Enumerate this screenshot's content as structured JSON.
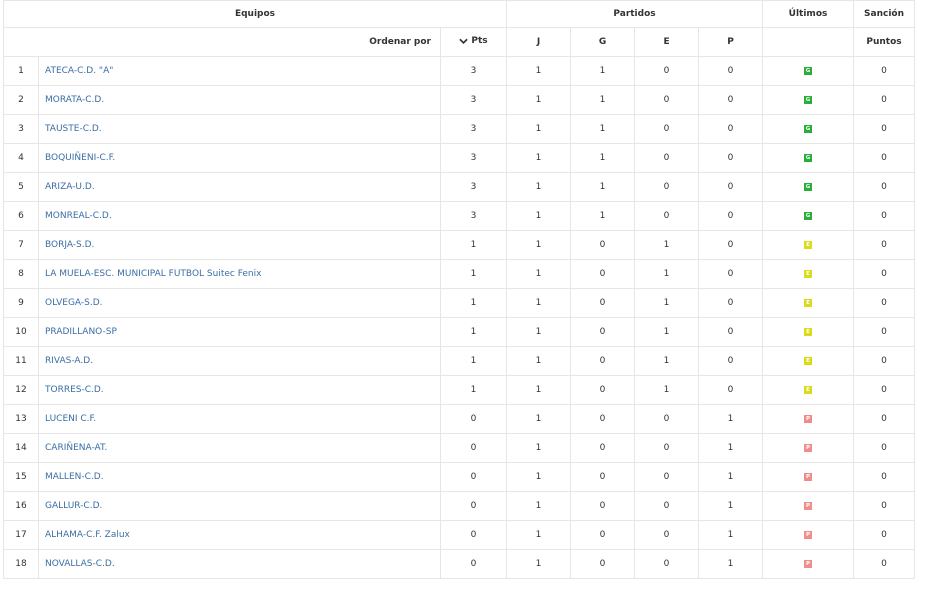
{
  "headers": {
    "equipos": "Equipos",
    "partidos": "Partidos",
    "ultimos": "Últimos",
    "sancion": "Sanción",
    "ordenar_por": "Ordenar por",
    "pts": "Pts",
    "j": "J",
    "g": "G",
    "e": "E",
    "p": "P",
    "puntos": "Puntos"
  },
  "icons": {
    "sort": "chevron-down-icon"
  },
  "colors": {
    "win": "#27ae3b",
    "draw": "#d8dc1c",
    "loss": "#ef8c8c",
    "link": "#3a6ea5"
  },
  "rows": [
    {
      "pos": "1",
      "team": "ATECA-C.D. \"A\"",
      "pts": "3",
      "j": "1",
      "g": "1",
      "e": "0",
      "p": "0",
      "last": "G",
      "sancion": "0"
    },
    {
      "pos": "2",
      "team": "MORATA-C.D.",
      "pts": "3",
      "j": "1",
      "g": "1",
      "e": "0",
      "p": "0",
      "last": "G",
      "sancion": "0"
    },
    {
      "pos": "3",
      "team": "TAUSTE-C.D.",
      "pts": "3",
      "j": "1",
      "g": "1",
      "e": "0",
      "p": "0",
      "last": "G",
      "sancion": "0"
    },
    {
      "pos": "4",
      "team": "BOQUIÑENI-C.F.",
      "pts": "3",
      "j": "1",
      "g": "1",
      "e": "0",
      "p": "0",
      "last": "G",
      "sancion": "0"
    },
    {
      "pos": "5",
      "team": "ARIZA-U.D.",
      "pts": "3",
      "j": "1",
      "g": "1",
      "e": "0",
      "p": "0",
      "last": "G",
      "sancion": "0"
    },
    {
      "pos": "6",
      "team": "MONREAL-C.D.",
      "pts": "3",
      "j": "1",
      "g": "1",
      "e": "0",
      "p": "0",
      "last": "G",
      "sancion": "0"
    },
    {
      "pos": "7",
      "team": "BORJA-S.D.",
      "pts": "1",
      "j": "1",
      "g": "0",
      "e": "1",
      "p": "0",
      "last": "E",
      "sancion": "0"
    },
    {
      "pos": "8",
      "team": "LA MUELA-ESC. MUNICIPAL FUTBOL Suitec Fenix",
      "pts": "1",
      "j": "1",
      "g": "0",
      "e": "1",
      "p": "0",
      "last": "E",
      "sancion": "0"
    },
    {
      "pos": "9",
      "team": "OLVEGA-S.D.",
      "pts": "1",
      "j": "1",
      "g": "0",
      "e": "1",
      "p": "0",
      "last": "E",
      "sancion": "0"
    },
    {
      "pos": "10",
      "team": "PRADILLANO-SP",
      "pts": "1",
      "j": "1",
      "g": "0",
      "e": "1",
      "p": "0",
      "last": "E",
      "sancion": "0"
    },
    {
      "pos": "11",
      "team": "RIVAS-A.D.",
      "pts": "1",
      "j": "1",
      "g": "0",
      "e": "1",
      "p": "0",
      "last": "E",
      "sancion": "0"
    },
    {
      "pos": "12",
      "team": "TORRES-C.D.",
      "pts": "1",
      "j": "1",
      "g": "0",
      "e": "1",
      "p": "0",
      "last": "E",
      "sancion": "0"
    },
    {
      "pos": "13",
      "team": "LUCENI C.F.",
      "pts": "0",
      "j": "1",
      "g": "0",
      "e": "0",
      "p": "1",
      "last": "P",
      "sancion": "0"
    },
    {
      "pos": "14",
      "team": "CARIÑENA-AT.",
      "pts": "0",
      "j": "1",
      "g": "0",
      "e": "0",
      "p": "1",
      "last": "P",
      "sancion": "0"
    },
    {
      "pos": "15",
      "team": "MALLEN-C.D.",
      "pts": "0",
      "j": "1",
      "g": "0",
      "e": "0",
      "p": "1",
      "last": "P",
      "sancion": "0"
    },
    {
      "pos": "16",
      "team": "GALLUR-C.D.",
      "pts": "0",
      "j": "1",
      "g": "0",
      "e": "0",
      "p": "1",
      "last": "P",
      "sancion": "0"
    },
    {
      "pos": "17",
      "team": "ALHAMA-C.F. Zalux",
      "pts": "0",
      "j": "1",
      "g": "0",
      "e": "0",
      "p": "1",
      "last": "P",
      "sancion": "0"
    },
    {
      "pos": "18",
      "team": "NOVALLAS-C.D.",
      "pts": "0",
      "j": "1",
      "g": "0",
      "e": "0",
      "p": "1",
      "last": "P",
      "sancion": "0"
    }
  ]
}
